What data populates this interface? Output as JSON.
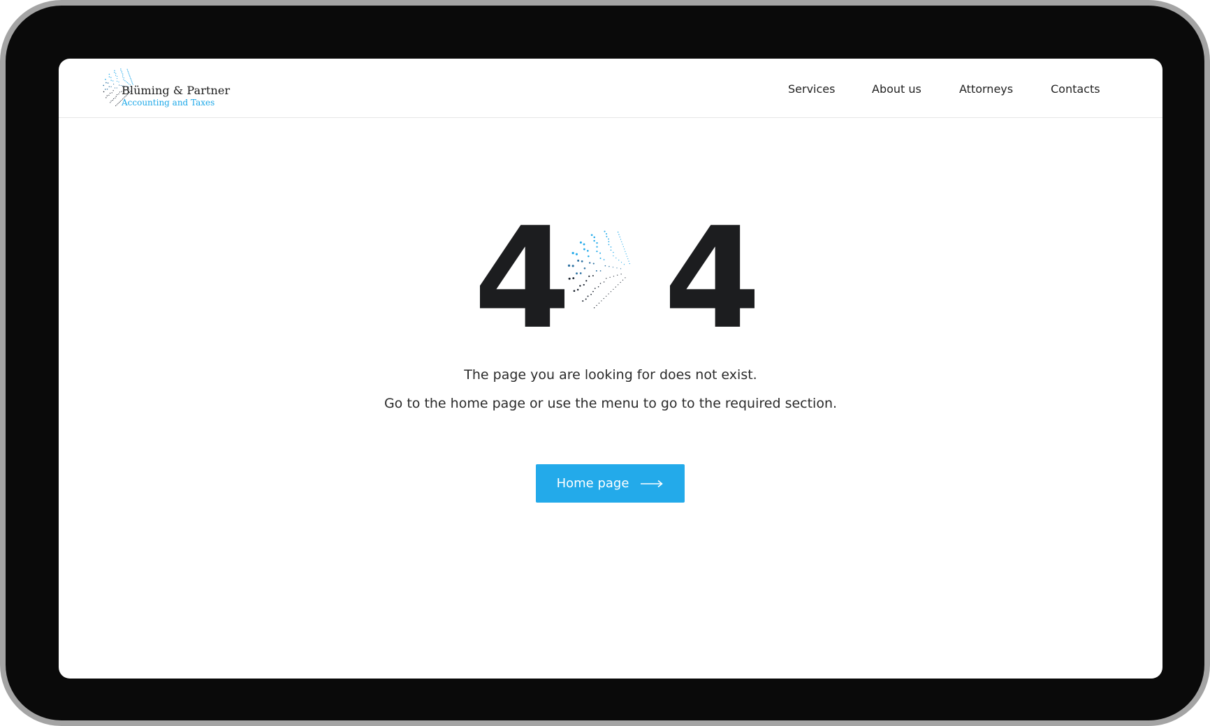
{
  "header": {
    "logo": {
      "name": "Blüming & Partner",
      "tagline": "Accounting and Taxes"
    },
    "nav": [
      {
        "label": "Services"
      },
      {
        "label": "About us"
      },
      {
        "label": "Attorneys"
      },
      {
        "label": "Contacts"
      }
    ]
  },
  "error": {
    "code_left": "4",
    "code_right": "4",
    "globe_icon": "dotted-globe-icon",
    "message_1": "The page you are looking for does not exist.",
    "message_2": "Go to the home page or use the menu to go to the required section."
  },
  "cta": {
    "label": "Home page",
    "icon": "long-arrow-right-icon"
  },
  "colors": {
    "accent": "#23aaea",
    "text_dark": "#1c1d1f",
    "device_frame": "#0a0a0a"
  }
}
